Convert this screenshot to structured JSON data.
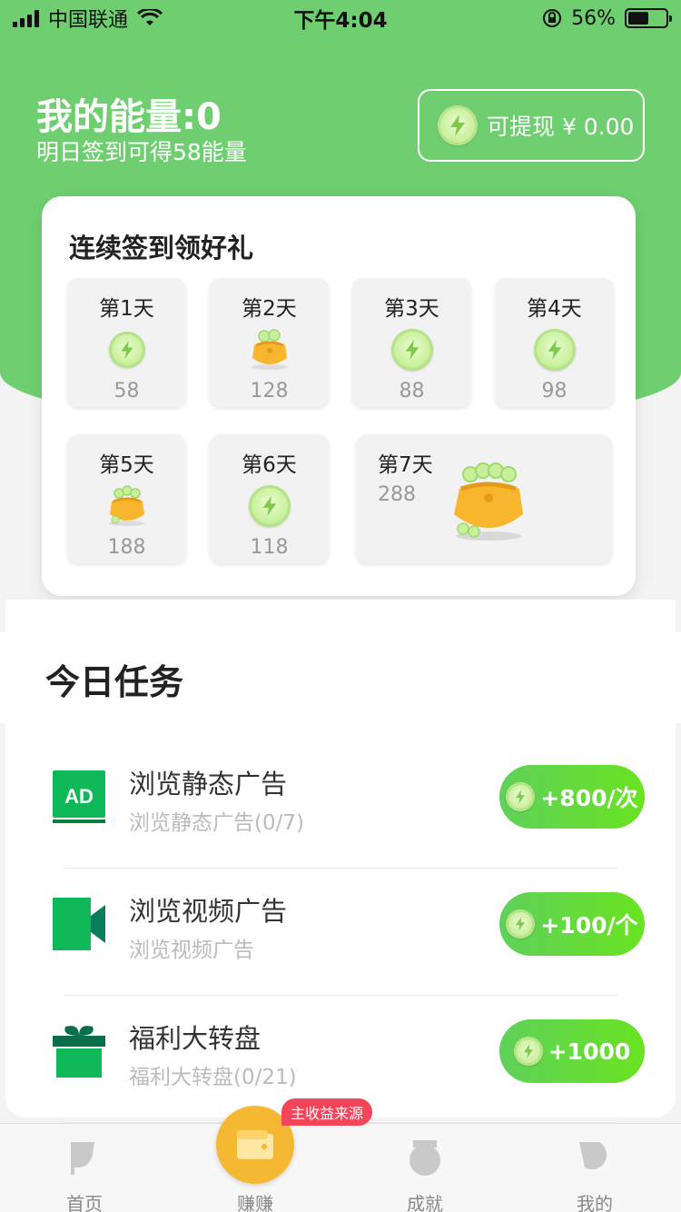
{
  "status_bar": {
    "carrier": "中国联通",
    "time": "下午4:04",
    "battery_percent": "56%",
    "battery_level": 0.56
  },
  "header": {
    "energy_title": "我的能量:0",
    "energy_subtitle": "明日签到可得58能量",
    "withdraw_label": "可提现 ¥ 0.00"
  },
  "signin": {
    "title": "连续签到领好礼",
    "days": [
      {
        "label": "第1天",
        "value": "58",
        "icon": "coin-icon"
      },
      {
        "label": "第2天",
        "value": "128",
        "icon": "money-bag-icon"
      },
      {
        "label": "第3天",
        "value": "88",
        "icon": "coin-icon"
      },
      {
        "label": "第4天",
        "value": "98",
        "icon": "coin-icon"
      },
      {
        "label": "第5天",
        "value": "188",
        "icon": "money-bag-icon"
      },
      {
        "label": "第6天",
        "value": "118",
        "icon": "coin-icon"
      },
      {
        "label": "第7天",
        "value": "288",
        "icon": "big-money-bag-icon"
      }
    ]
  },
  "tasks": {
    "title": "今日任务",
    "items": [
      {
        "name": "浏览静态广告",
        "desc": "浏览静态广告(0/7)",
        "reward": "+800/次",
        "icon": "ad-icon"
      },
      {
        "name": "浏览视频广告",
        "desc": "浏览视频广告",
        "reward": "+100/个",
        "icon": "video-icon"
      },
      {
        "name": "福利大转盘",
        "desc": "福利大转盘(0/21)",
        "reward": "+1000",
        "icon": "gift-icon"
      }
    ]
  },
  "tabbar": {
    "items": [
      {
        "label": "首页",
        "icon": "flag-icon"
      },
      {
        "label": "赚赚",
        "icon": "wallet-icon"
      },
      {
        "label": "成就",
        "icon": "medal-icon"
      },
      {
        "label": "我的",
        "icon": "user-icon"
      }
    ],
    "earn_badge": "主收益来源"
  },
  "colors": {
    "brand_green": "#6fcf70",
    "button_green": "#5fd15a",
    "badge_red": "#f5455a",
    "earn_orange": "#f5b832"
  }
}
